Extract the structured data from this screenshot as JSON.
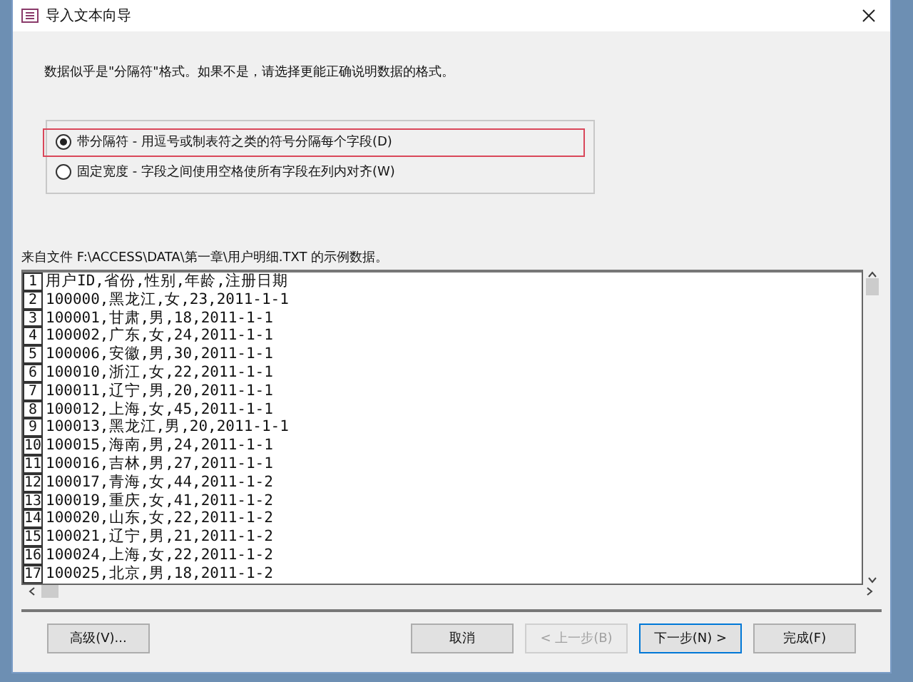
{
  "window": {
    "title": "导入文本向导"
  },
  "instruction": "数据似乎是\"分隔符\"格式。如果不是，请选择更能正确说明数据的格式。",
  "options": [
    {
      "label": "带分隔符 - 用逗号或制表符之类的符号分隔每个字段(D)",
      "selected": true,
      "highlighted": true
    },
    {
      "label": "固定宽度 - 字段之间使用空格使所有字段在列内对齐(W)",
      "selected": false,
      "highlighted": false
    }
  ],
  "source_label": "来自文件 F:\\ACCESS\\DATA\\第一章\\用户明细.TXT 的示例数据。",
  "preview_rows": [
    {
      "number": "1",
      "text": "用户ID,省份,性别,年龄,注册日期"
    },
    {
      "number": "2",
      "text": "100000,黑龙江,女,23,2011-1-1"
    },
    {
      "number": "3",
      "text": "100001,甘肃,男,18,2011-1-1"
    },
    {
      "number": "4",
      "text": "100002,广东,女,24,2011-1-1"
    },
    {
      "number": "5",
      "text": "100006,安徽,男,30,2011-1-1"
    },
    {
      "number": "6",
      "text": "100010,浙江,女,22,2011-1-1"
    },
    {
      "number": "7",
      "text": "100011,辽宁,男,20,2011-1-1"
    },
    {
      "number": "8",
      "text": "100012,上海,女,45,2011-1-1"
    },
    {
      "number": "9",
      "text": "100013,黑龙江,男,20,2011-1-1"
    },
    {
      "number": "10",
      "text": "100015,海南,男,24,2011-1-1"
    },
    {
      "number": "11",
      "text": "100016,吉林,男,27,2011-1-1"
    },
    {
      "number": "12",
      "text": "100017,青海,女,44,2011-1-2"
    },
    {
      "number": "13",
      "text": "100019,重庆,女,41,2011-1-2"
    },
    {
      "number": "14",
      "text": "100020,山东,女,22,2011-1-2"
    },
    {
      "number": "15",
      "text": "100021,辽宁,男,21,2011-1-2"
    },
    {
      "number": "16",
      "text": "100024,上海,女,22,2011-1-2"
    },
    {
      "number": "17",
      "text": "100025,北京,男,18,2011-1-2"
    }
  ],
  "buttons": [
    {
      "label": "高级(V)...",
      "disabled": false,
      "kind": "left"
    },
    {
      "label": "取消",
      "disabled": false,
      "kind": "right"
    },
    {
      "label": "< 上一步(B)",
      "disabled": true,
      "kind": "right"
    },
    {
      "label": "下一步(N) >",
      "disabled": false,
      "kind": "right"
    },
    {
      "label": "完成(F)",
      "disabled": false,
      "kind": "right"
    }
  ]
}
